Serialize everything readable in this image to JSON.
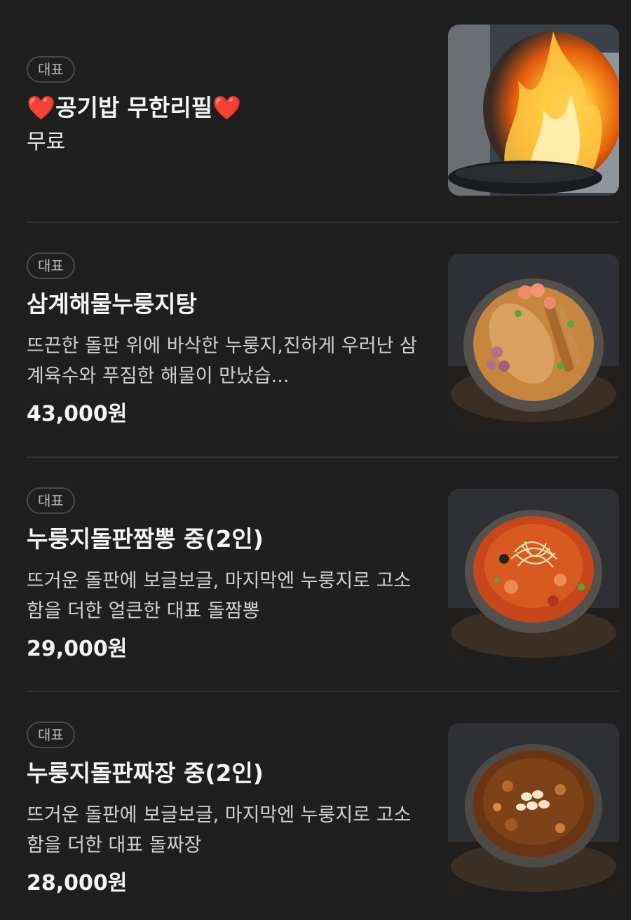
{
  "items": [
    {
      "badge": "대표",
      "heart_left": "❤️",
      "name": "공기밥 무한리필",
      "heart_right": "❤️",
      "price": "무료",
      "image_icon": "fire-wok-photo"
    },
    {
      "badge": "대표",
      "name": "삼계해물누룽지탕",
      "description": "뜨끈한 돌판 위에 바삭한 누룽지,진하게 우러난 삼계육수와 푸짐한 해물이 만났습...",
      "price": "43,000원",
      "image_icon": "seafood-stew-photo"
    },
    {
      "badge": "대표",
      "name": "누룽지돌판짬뽕 중(2인)",
      "description": "뜨거운 돌판에 보글보글, 마지막엔 누룽지로 고소함을 더한 얼큰한 대표 돌짬뽕",
      "price": "29,000원",
      "image_icon": "jjamppong-photo"
    },
    {
      "badge": "대표",
      "name": "누룽지돌판짜장 중(2인)",
      "description": "뜨거운 돌판에 보글보글, 마지막엔 누룽지로 고소함을 더한 대표 돌짜장",
      "price": "28,000원",
      "image_icon": "jjajang-photo"
    }
  ]
}
